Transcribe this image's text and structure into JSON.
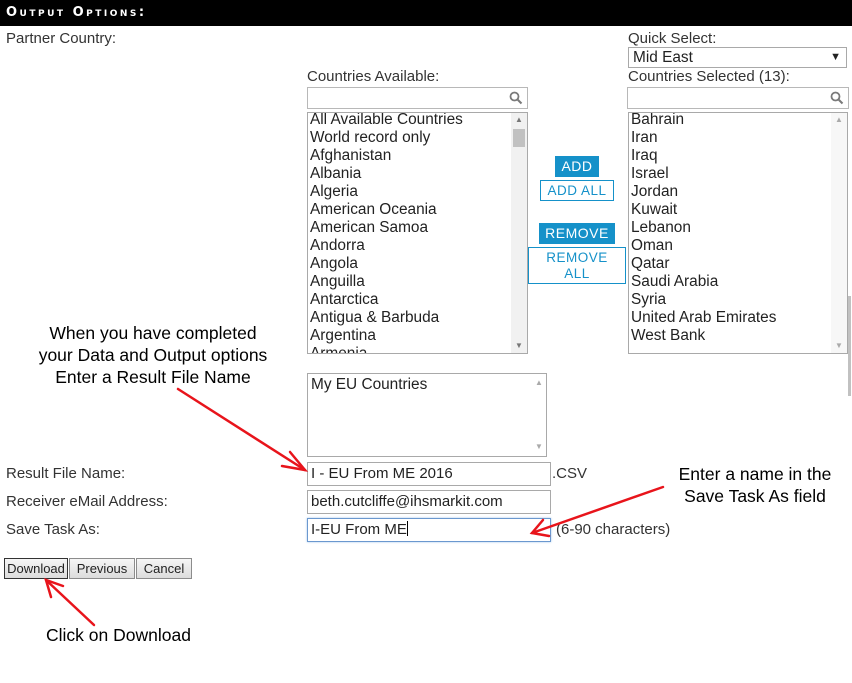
{
  "header": {
    "title": "Output Options:"
  },
  "partner_country": {
    "label": "Partner Country:",
    "quick_select": {
      "label": "Quick Select:",
      "value": "Mid East"
    },
    "available": {
      "label": "Countries Available:",
      "search_value": "",
      "items": [
        "All Available Countries",
        "World record only",
        "Afghanistan",
        "Albania",
        "Algeria",
        "American Oceania",
        "American Samoa",
        "Andorra",
        "Angola",
        "Anguilla",
        "Antarctica",
        "Antigua & Barbuda",
        "Argentina",
        "Armenia"
      ]
    },
    "selected": {
      "label": "Countries Selected (13):",
      "search_value": "",
      "items": [
        "Bahrain",
        "Iran",
        "Iraq",
        "Israel",
        "Jordan",
        "Kuwait",
        "Lebanon",
        "Oman",
        "Qatar",
        "Saudi Arabia",
        "Syria",
        "United Arab Emirates",
        "West Bank"
      ]
    },
    "buttons": {
      "add": "ADD",
      "add_all": "ADD ALL",
      "remove": "REMOVE",
      "remove_all_1": "REMOVE",
      "remove_all_2": "ALL"
    }
  },
  "description": {
    "value": "My EU Countries"
  },
  "form": {
    "result_file": {
      "label": "Result File Name:",
      "value": "I - EU From ME 2016",
      "suffix": ".CSV"
    },
    "email": {
      "label": "Receiver eMail Address:",
      "value": "beth.cutcliffe@ihsmarkit.com"
    },
    "save_task": {
      "label": "Save Task As:",
      "value": "I-EU From ME",
      "hint": "(6-90 characters)"
    }
  },
  "actions": {
    "download": "Download",
    "previous": "Previous",
    "cancel": "Cancel"
  },
  "annotations": {
    "left_note": [
      "When you have completed",
      "your Data and Output options",
      "Enter a Result File Name"
    ],
    "right_note": [
      "Enter a name in the",
      "Save Task As field"
    ],
    "bottom_note": "Click on Download",
    "arrow_color": "#e8141b"
  },
  "colors": {
    "accent": "#1591c9",
    "header_bg": "#000000"
  }
}
